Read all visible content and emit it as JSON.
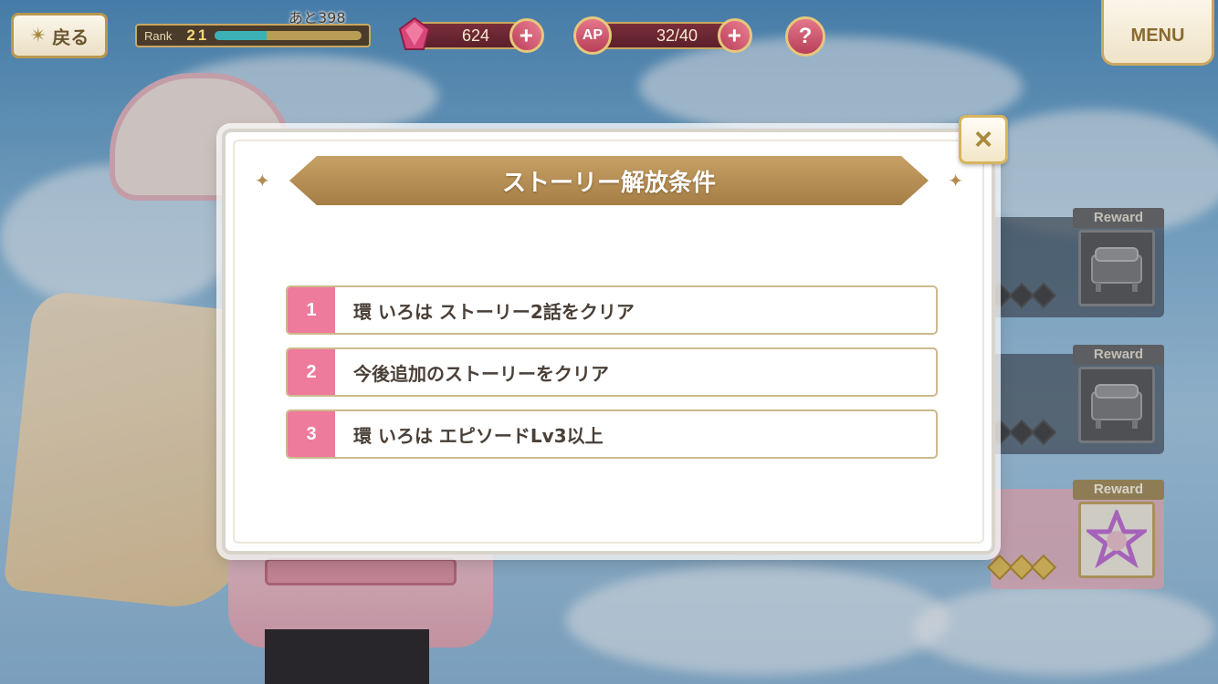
{
  "header": {
    "back_label": "戻る",
    "rank_label": "Rank",
    "rank_value": "21",
    "rank_remaining": "あと398",
    "rank_exp_fraction": 0.35,
    "gems": "624",
    "ap_label": "AP",
    "ap_value": "32/40",
    "help_label": "?",
    "menu_label": "MENU"
  },
  "modal": {
    "title": "ストーリー解放条件",
    "close_label": "×",
    "conditions": [
      {
        "num": "1",
        "text": "環 いろは ストーリー2話をクリア"
      },
      {
        "num": "2",
        "text": "今後追加のストーリーをクリア"
      },
      {
        "num": "3",
        "text": "環 いろは エピソードLv3以上"
      }
    ]
  },
  "rewards": {
    "label": "Reward"
  },
  "colors": {
    "accent_pink": "#ee7a9c",
    "gold": "#c9a860",
    "header_brown": "#a47e45"
  }
}
